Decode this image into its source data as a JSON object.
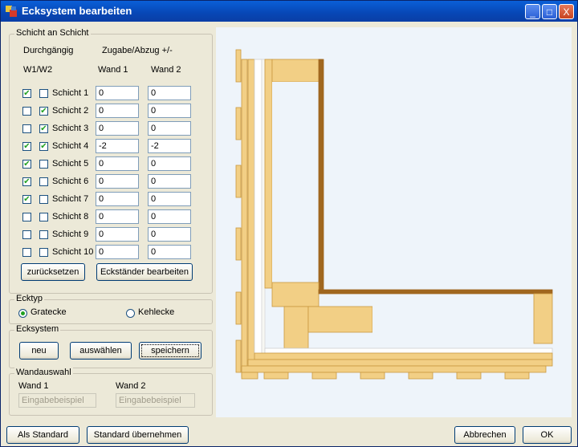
{
  "window": {
    "title": "Ecksystem bearbeiten",
    "minimize": "_",
    "maximize": "□",
    "close": "X"
  },
  "schicht": {
    "legend": "Schicht an Schicht",
    "col_durchgaengig": "Durchgängig",
    "col_zugabe": "Zugabe/Abzug +/-",
    "col_w1w2": "W1/W2",
    "col_wand1": "Wand 1",
    "col_wand2": "Wand 2",
    "rows": [
      {
        "label": "Schicht 1",
        "c1": true,
        "c2": false,
        "w1": "0",
        "w2": "0"
      },
      {
        "label": "Schicht 2",
        "c1": false,
        "c2": true,
        "w1": "0",
        "w2": "0"
      },
      {
        "label": "Schicht 3",
        "c1": false,
        "c2": true,
        "w1": "0",
        "w2": "0"
      },
      {
        "label": "Schicht 4",
        "c1": true,
        "c2": true,
        "w1": "-2",
        "w2": "-2"
      },
      {
        "label": "Schicht 5",
        "c1": true,
        "c2": false,
        "w1": "0",
        "w2": "0"
      },
      {
        "label": "Schicht 6",
        "c1": true,
        "c2": false,
        "w1": "0",
        "w2": "0"
      },
      {
        "label": "Schicht 7",
        "c1": true,
        "c2": false,
        "w1": "0",
        "w2": "0"
      },
      {
        "label": "Schicht 8",
        "c1": false,
        "c2": false,
        "w1": "0",
        "w2": "0"
      },
      {
        "label": "Schicht 9",
        "c1": false,
        "c2": false,
        "w1": "0",
        "w2": "0"
      },
      {
        "label": "Schicht 10",
        "c1": false,
        "c2": false,
        "w1": "0",
        "w2": "0"
      }
    ],
    "reset_button": "zurücksetzen",
    "eckstaender_button": "Eckständer bearbeiten"
  },
  "ecktyp": {
    "legend": "Ecktyp",
    "option1": "Gratecke",
    "option2": "Kehlecke",
    "selected": "Gratecke"
  },
  "ecksystem": {
    "legend": "Ecksystem",
    "new_button": "neu",
    "select_button": "auswählen",
    "save_button": "speichern"
  },
  "wandauswahl": {
    "legend": "Wandauswahl",
    "wand1_label": "Wand 1",
    "wand1_value": "Eingabebeispiel",
    "wand2_label": "Wand 2",
    "wand2_value": "Eingabebeispiel"
  },
  "footer": {
    "als_standard": "Als Standard",
    "standard_uebernehmen": "Standard übernehmen",
    "abbrechen": "Abbrechen",
    "ok": "OK"
  },
  "colors": {
    "wood": "#f2cf85",
    "wood_dark": "#c9983f",
    "osb": "#a0671f",
    "canvas_bg": "#eef4fa",
    "titlebar": "#0a5fd8"
  }
}
